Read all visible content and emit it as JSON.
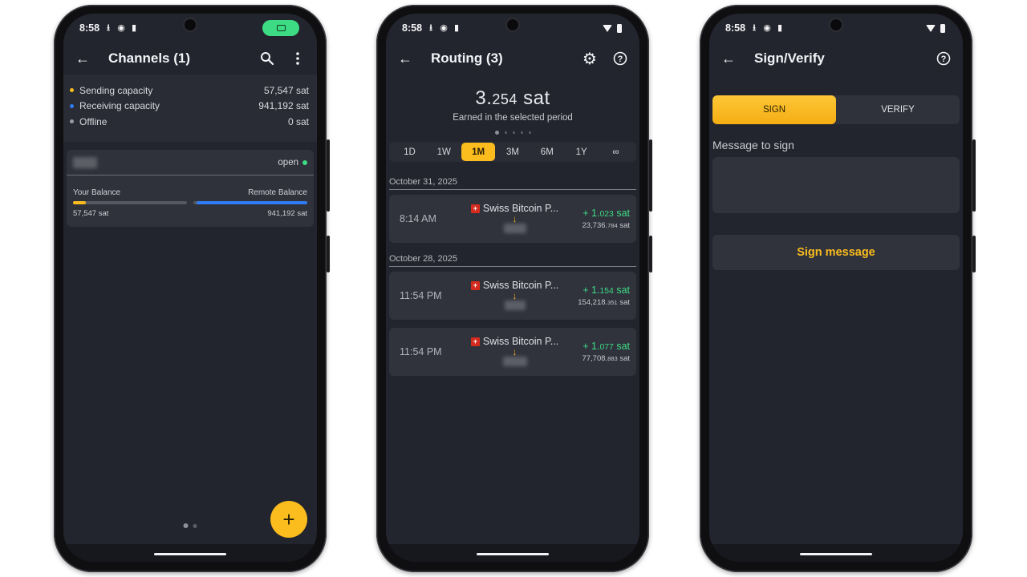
{
  "status": {
    "time": "8:58"
  },
  "colors": {
    "accent": "#fbbc1d",
    "positive": "#3ddc84",
    "receiving": "#2e7cf6",
    "offline": "#9a9ca5",
    "background": "#23252e"
  },
  "channels_screen": {
    "title": "Channels (1)",
    "icons": {
      "back": "arrow-left-icon",
      "search": "search-icon",
      "menu": "more-vert-icon",
      "fab": "plus-icon"
    },
    "summary": [
      {
        "label": "Sending capacity",
        "value": "57,547 sat",
        "color": "#fbbc1d"
      },
      {
        "label": "Receiving capacity",
        "value": "941,192 sat",
        "color": "#2e7cf6"
      },
      {
        "label": "Offline",
        "value": "0 sat",
        "color": "#9a9ca5"
      }
    ],
    "channel": {
      "status": "open",
      "your_balance_label": "Your Balance",
      "remote_balance_label": "Remote Balance",
      "your_balance": "57,547 sat",
      "remote_balance": "941,192 sat",
      "local_fill": 0.058
    },
    "fab_label": "+"
  },
  "routing_screen": {
    "title": "Routing (3)",
    "earned_main": "3.",
    "earned_decimals": "254",
    "earned_unit": " sat",
    "earned_caption": "Earned in the selected period",
    "periods": [
      "1D",
      "1W",
      "1M",
      "3M",
      "6M",
      "1Y",
      "∞"
    ],
    "selected_period": "1M",
    "groups": [
      {
        "date": "October 31, 2025",
        "events": [
          {
            "time": "8:14 AM",
            "peer": "Swiss Bitcoin P...",
            "fee_main": "+ 1.",
            "fee_dec": "023",
            "fee_unit": " sat",
            "amount_main": "23,736.",
            "amount_dec": "784",
            "amount_unit": " sat"
          }
        ]
      },
      {
        "date": "October 28, 2025",
        "events": [
          {
            "time": "11:54 PM",
            "peer": "Swiss Bitcoin P...",
            "fee_main": "+ 1.",
            "fee_dec": "154",
            "fee_unit": " sat",
            "amount_main": "154,218.",
            "amount_dec": "351",
            "amount_unit": " sat"
          },
          {
            "time": "11:54 PM",
            "peer": "Swiss Bitcoin P...",
            "fee_main": "+ 1.",
            "fee_dec": "077",
            "fee_unit": " sat",
            "amount_main": "77,708.",
            "amount_dec": "883",
            "amount_unit": " sat"
          }
        ]
      }
    ]
  },
  "sign_screen": {
    "title": "Sign/Verify",
    "tabs": [
      "SIGN",
      "VERIFY"
    ],
    "selected_tab": "SIGN",
    "message_label": "Message to sign",
    "message_value": "",
    "sign_button": "Sign message"
  }
}
